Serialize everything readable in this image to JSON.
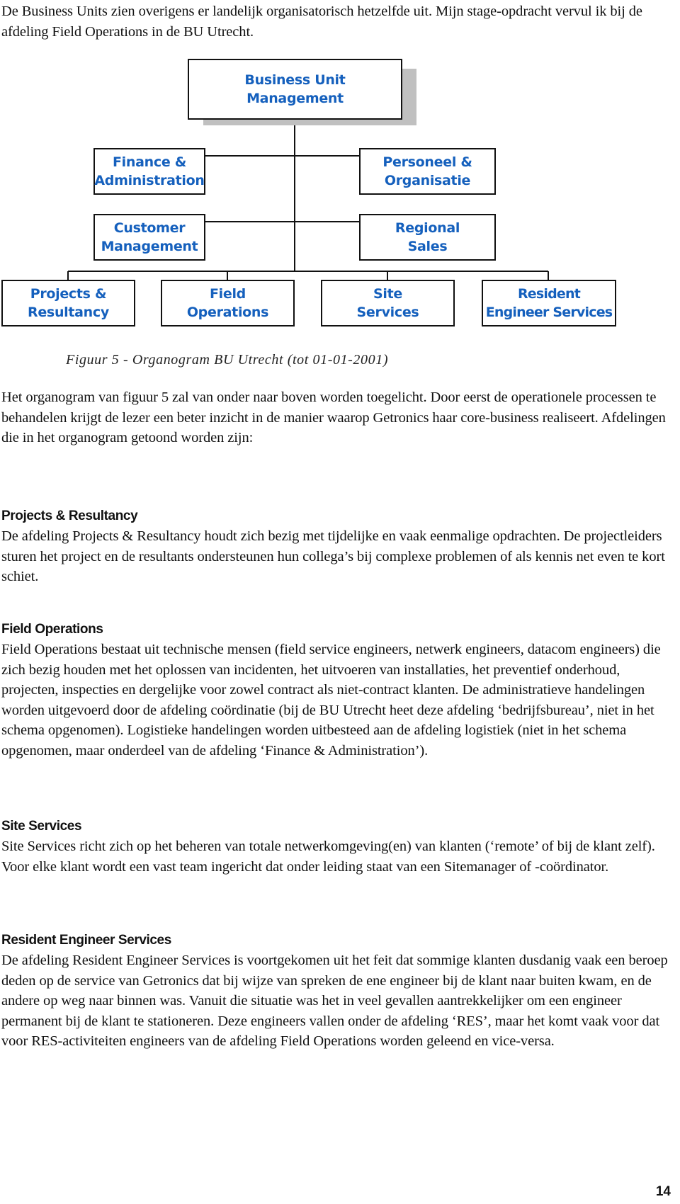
{
  "intro": {
    "text": "De Business Units zien overigens er landelijk organisatorisch hetzelfde uit. Mijn stage-opdracht vervul ik bij de afdeling Field Operations in de BU Utrecht."
  },
  "organogram": {
    "top": {
      "line1": "Business Unit",
      "line2": "Management"
    },
    "staff": [
      {
        "line1": "Finance &",
        "line2": "Administration"
      },
      {
        "line1": "Personeel &",
        "line2": "Organisatie"
      },
      {
        "line1": "Customer",
        "line2": "Management"
      },
      {
        "line1": "Regional",
        "line2": "Sales"
      }
    ],
    "departments": [
      {
        "line1": "Projects &",
        "line2": "Resultancy"
      },
      {
        "line1": "Field",
        "line2": "Operations"
      },
      {
        "line1": "Site",
        "line2": "Services"
      },
      {
        "line1": "Resident",
        "line2": "Engineer Services"
      }
    ],
    "colors": {
      "box_text": "#1560bd",
      "border": "#111111",
      "shadow": "#c0c0c0"
    }
  },
  "caption": "Figuur 5 - Organogram BU Utrecht (tot 01-01-2001)",
  "explanation": "Het organogram van figuur 5 zal van onder naar boven worden toegelicht. Door eerst de operationele processen te behandelen krijgt de lezer een beter inzicht in de manier waarop Getronics haar core-business realiseert. Afdelingen die in het organogram getoond worden zijn:",
  "sections": [
    {
      "heading": "Projects & Resultancy",
      "text": "De afdeling Projects & Resultancy houdt zich bezig met tijdelijke en vaak eenmalige opdrachten. De projectleiders sturen het project en de resultants ondersteunen hun collega’s bij complexe problemen of als kennis net even te kort schiet."
    },
    {
      "heading": "Field Operations",
      "text": "Field Operations bestaat uit technische mensen (field service engineers, netwerk engineers, datacom engineers) die zich bezig houden met het oplossen van incidenten, het uitvoeren van installaties, het preventief onderhoud, projecten, inspecties en dergelijke voor zowel contract als niet-contract klanten. De administratieve handelingen worden uitgevoerd door de afdeling coördinatie (bij de BU Utrecht heet deze afdeling ‘bedrijfsbureau’, niet in het schema opgenomen). Logistieke handelingen worden uitbesteed aan de afdeling logistiek (niet in het schema opgenomen, maar onderdeel van de afdeling ‘Finance & Administration’)."
    },
    {
      "heading": "Site Services",
      "text": "Site Services richt zich op het beheren van totale netwerkomgeving(en) van klanten (‘remote’ of bij de klant zelf). Voor elke klant wordt een vast team ingericht dat onder leiding staat van een Sitemanager of -coördinator."
    },
    {
      "heading": "Resident Engineer Services",
      "text": "De afdeling Resident Engineer Services is voortgekomen uit het feit dat sommige klanten dusdanig vaak een beroep deden op de service van Getronics dat bij wijze van spreken de ene engineer bij de klant naar buiten kwam, en de andere op weg naar binnen was. Vanuit die situatie was het in veel gevallen aantrekkelijker om een engineer permanent bij de klant te stationeren. Deze engineers vallen onder de afdeling ‘RES’, maar het komt vaak voor dat voor RES-activiteiten engineers van de afdeling Field Operations worden geleend en vice-versa."
    }
  ],
  "page_number": "14"
}
